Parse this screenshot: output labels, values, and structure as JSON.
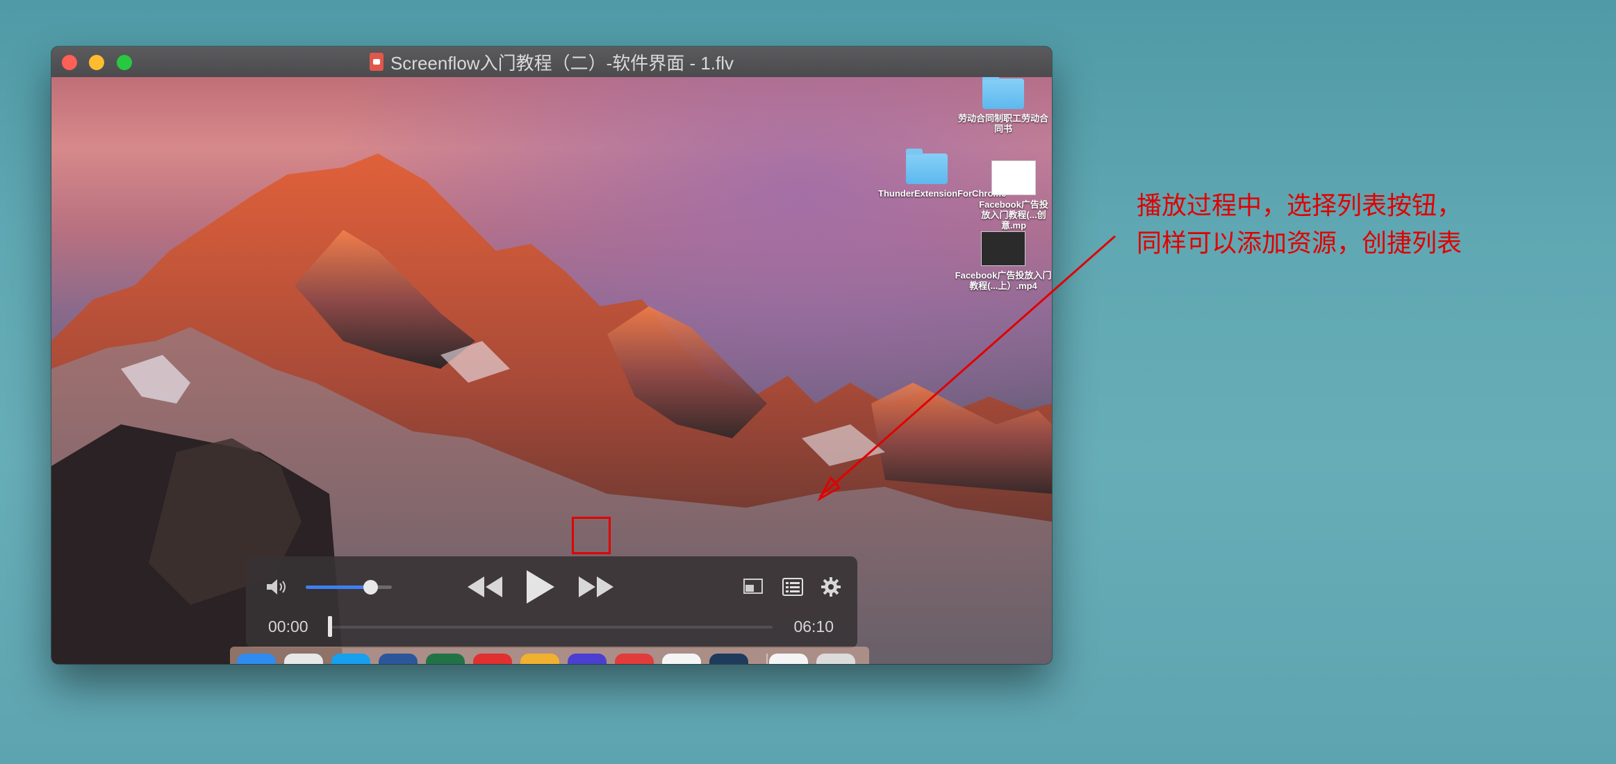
{
  "window": {
    "title": "Screenflow入门教程（二）-软件界面 - 1.flv"
  },
  "desktop_icons": [
    {
      "label": "劳动合同制职工劳动合同书",
      "kind": "folder"
    },
    {
      "label": "ThunderExtensionForChrome",
      "kind": "folder"
    },
    {
      "label": "Facebook广告投放入门教程(...创意.mp",
      "kind": "video-thumb"
    },
    {
      "label": "Facebook广告投放入门教程(...上）.mp4",
      "kind": "video-thumb"
    }
  ],
  "player": {
    "volume_level": 0.75,
    "current_time": "00:00",
    "duration": "06:10",
    "progress": 0.0,
    "icons": [
      "volume-icon",
      "rewind-icon",
      "play-icon",
      "fast-forward-icon",
      "picture-in-picture-icon",
      "playlist-icon",
      "settings-icon"
    ]
  },
  "dock": {
    "apps": [
      {
        "name": "Finder",
        "icon": "finder-icon",
        "color": "#2f8bf0"
      },
      {
        "name": "Chrome",
        "icon": "chrome-icon",
        "color": "#e8e8e8"
      },
      {
        "name": "Skype",
        "icon": "skype-icon",
        "color": "#16a0ef"
      },
      {
        "name": "Word",
        "icon": "word-icon",
        "color": "#2b579a"
      },
      {
        "name": "Excel",
        "icon": "excel-icon",
        "color": "#217346"
      },
      {
        "name": "Bear",
        "icon": "bear-icon",
        "color": "#e03030"
      },
      {
        "name": "Tes",
        "icon": "butterfly-icon",
        "color": "#f0b030"
      },
      {
        "name": "Photo Booth",
        "icon": "photo-booth-icon",
        "color": "#4b3fd1"
      },
      {
        "name": "PDF",
        "icon": "pdf-icon",
        "color": "#e23b3b"
      },
      {
        "name": "iTunes",
        "icon": "itunes-icon",
        "color": "#f5f5f5"
      },
      {
        "name": "QuickTime",
        "icon": "quicktime-icon",
        "color": "#1e3a5c"
      },
      {
        "name": "Document",
        "icon": "document-icon",
        "color": "#f5f5f5"
      },
      {
        "name": "Trash",
        "icon": "trash-icon",
        "color": "#dcdcdc"
      }
    ]
  },
  "annotation": {
    "line1": "播放过程中，选择列表按钮，",
    "line2": "同样可以添加资源，创捷列表",
    "color": "#e00000"
  }
}
